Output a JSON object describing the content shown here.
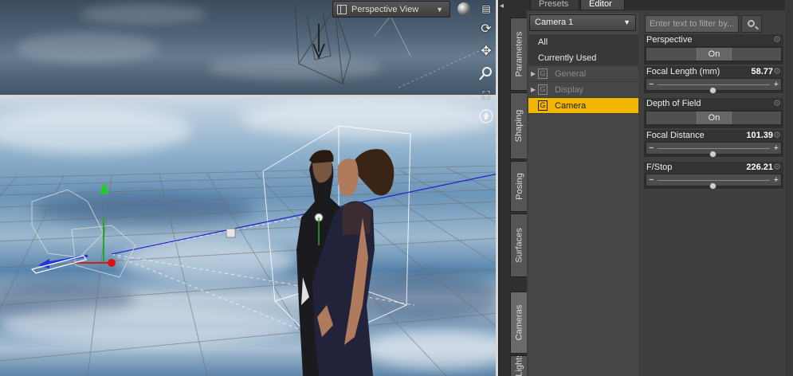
{
  "viewport": {
    "view_selector": "Perspective View",
    "tools": [
      "orbit-icon",
      "move-icon",
      "zoom-icon",
      "frame-icon",
      "home-icon"
    ]
  },
  "side_tabs": [
    {
      "label": "Parameters",
      "active": false
    },
    {
      "label": "Shaping",
      "active": false
    },
    {
      "label": "Posing",
      "active": false
    },
    {
      "label": "Surfaces",
      "active": false
    },
    {
      "label": "Cameras",
      "active": true
    },
    {
      "label": "Lights",
      "active": false
    }
  ],
  "panel": {
    "tabs": [
      {
        "label": "Presets",
        "active": false
      },
      {
        "label": "Editor",
        "active": true
      }
    ],
    "node_select": "Camera 1",
    "tree": [
      {
        "label": "All",
        "group": false
      },
      {
        "label": "Currently Used",
        "group": false
      },
      {
        "label": "General",
        "group": true,
        "dim": true
      },
      {
        "label": "Display",
        "group": true,
        "dim": true
      },
      {
        "label": "Camera",
        "group": true,
        "selected": true
      }
    ],
    "filter_placeholder": "Enter text to filter by...",
    "properties": [
      {
        "label": "Perspective",
        "kind": "toggle",
        "value": "On"
      },
      {
        "label": "Focal Length (mm)",
        "kind": "slider",
        "value": "58.77",
        "fraction": 0.49
      },
      {
        "label": "Depth of Field",
        "kind": "toggle",
        "value": "On"
      },
      {
        "label": "Focal Distance",
        "kind": "slider",
        "value": "101.39",
        "fraction": 0.49
      },
      {
        "label": "F/Stop",
        "kind": "slider",
        "value": "226.21",
        "fraction": 0.49
      }
    ]
  }
}
